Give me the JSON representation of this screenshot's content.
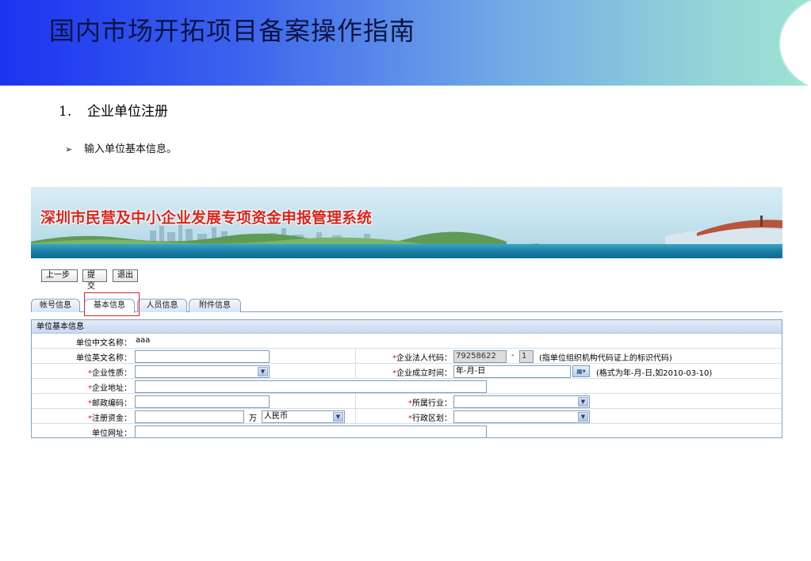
{
  "slide": {
    "title": "国内市场开拓项目备案操作指南",
    "step_number": "1.",
    "step_title": "企业单位注册",
    "bullet_symbol": "➢",
    "bullet_text": "输入单位基本信息。"
  },
  "app": {
    "banner_title": "深圳市民营及中小企业发展专项资金申报管理系统",
    "toolbar": {
      "prev_label": "上一步",
      "submit_label": "提交",
      "exit_label": "退出"
    },
    "tabs": [
      {
        "label": "帐号信息"
      },
      {
        "label": "基本信息"
      },
      {
        "label": "人员信息"
      },
      {
        "label": "附件信息"
      }
    ],
    "form": {
      "section_title": "单位基本信息",
      "cn_name_label": "单位中文名称：",
      "cn_name_value": "aaa",
      "en_name_label": "单位英文名称：",
      "en_name_value": "",
      "legal_code_label": "企业法人代码：",
      "legal_code_value": "79258622",
      "legal_code_dash": "-",
      "legal_code_suffix": "1",
      "legal_code_hint": "(指单位组织机构代码证上的标识代码)",
      "nature_label": "企业性质：",
      "nature_value": "",
      "founded_label": "企业成立时间：",
      "founded_value": "年-月-日",
      "founded_hint": "(格式为年-月-日,如2010-03-10)",
      "address_label": "企业地址：",
      "address_value": "",
      "postcode_label": "邮政编码：",
      "postcode_value": "",
      "industry_label": "所属行业：",
      "industry_value": "",
      "capital_label": "注册资金：",
      "capital_value": "",
      "capital_unit": "万",
      "currency_value": "人民币",
      "district_label": "行政区划：",
      "district_value": "",
      "website_label": "单位网址：",
      "website_value": "",
      "required_mark": "*"
    }
  },
  "colors": {
    "header_gradient_start": "#1b33f0",
    "header_gradient_end": "#9ee3d3",
    "banner_title_red": "#d9261c",
    "required_star": "#e01818",
    "highlight_box": "#d6262c",
    "tab_border": "#7da2ce"
  },
  "icons": {
    "dropdown": "chevron-down-icon",
    "calendar": "calendar-icon",
    "bullet": "arrow-bullet-icon"
  }
}
